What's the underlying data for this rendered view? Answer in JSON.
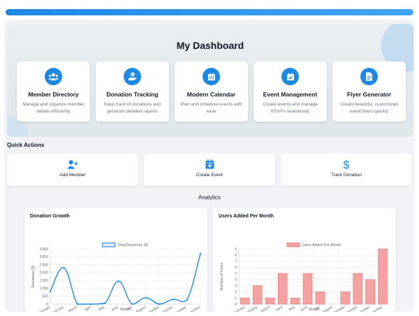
{
  "dashboard": {
    "title": "My Dashboard"
  },
  "features": [
    {
      "title": "Member Directory",
      "desc": "Manage and organize member details efficiently",
      "icon": "users-icon"
    },
    {
      "title": "Donation Tracking",
      "desc": "Keep track of donations and generate detailed reports",
      "icon": "donation-hand-icon"
    },
    {
      "title": "Modern Calendar",
      "desc": "Plan and schedule events with ease",
      "icon": "calendar-icon"
    },
    {
      "title": "Event Management",
      "desc": "Create events and manage RSVPs seamlessly",
      "icon": "calendar-check-icon"
    },
    {
      "title": "Flyer Generator",
      "desc": "Create beautiful, customized event flyers quickly",
      "icon": "document-icon"
    }
  ],
  "quick_actions": {
    "title": "Quick Actions",
    "items": [
      {
        "label": "Add Member",
        "icon": "user-plus-icon"
      },
      {
        "label": "Create Event",
        "icon": "calendar-plus-icon"
      },
      {
        "label": "Track Donation",
        "icon": "dollar-icon"
      }
    ]
  },
  "analytics": {
    "title": "Analytics"
  },
  "colors": {
    "accent": "#1e88e5",
    "line": "#1e88e5",
    "bar_fill": "#f4a3a3",
    "bar_stroke": "#ef6b6b"
  },
  "chart_data": [
    {
      "type": "line",
      "title": "Donation Growth",
      "legend": "Total Donations ($)",
      "legend_position": "top",
      "xlabel": "Month",
      "ylabel": "Donations ($)",
      "categories": [
        "January",
        "February",
        "March",
        "April",
        "May",
        "June",
        "July",
        "August",
        "September",
        "October",
        "November",
        "December"
      ],
      "values": [
        800,
        2300,
        0,
        0,
        50,
        1450,
        0,
        400,
        0,
        300,
        250,
        3200
      ],
      "ylim": [
        0,
        3500
      ],
      "yticks": [
        0,
        500,
        1000,
        1500,
        2000,
        2500,
        3000,
        3500
      ],
      "ytick_labels": [
        "0",
        "500",
        "1,000",
        "1,500",
        "2,000",
        "2,500",
        "3,000",
        "3,500"
      ],
      "grid": true
    },
    {
      "type": "bar",
      "title": "Users Added Per Month",
      "legend": "Users Added Per Month",
      "legend_position": "top",
      "xlabel": "Month",
      "ylabel": "Number of Users",
      "categories": [
        "January",
        "February",
        "March",
        "April",
        "May",
        "June",
        "July",
        "August",
        "September",
        "October",
        "November",
        "December"
      ],
      "values": [
        1,
        3,
        1,
        5,
        1,
        5,
        2,
        0,
        2,
        5,
        4,
        9
      ],
      "ylim": [
        0,
        9
      ],
      "yticks": [
        0,
        1,
        2,
        3,
        4,
        5,
        6,
        7,
        8,
        9
      ],
      "ytick_labels": [
        "0",
        "1",
        "2",
        "3",
        "4",
        "5",
        "6",
        "7",
        "8",
        "9"
      ],
      "grid": true
    }
  ]
}
